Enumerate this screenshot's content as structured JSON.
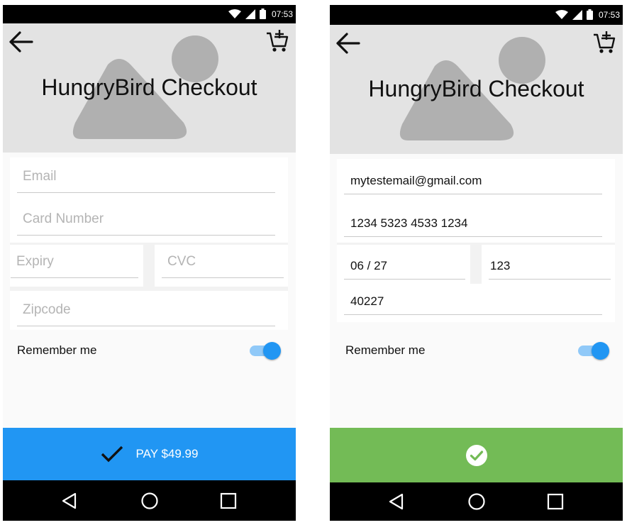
{
  "status_bar": {
    "time": "07:53"
  },
  "app": {
    "title": "HungryBird Checkout"
  },
  "checkout_empty": {
    "email_placeholder": "Email",
    "card_placeholder": "Card Number",
    "expiry_placeholder": "Expiry",
    "cvc_placeholder": "CVC",
    "zip_placeholder": "Zipcode",
    "remember_label": "Remember me",
    "remember_on": true,
    "pay_label": "PAY $49.99"
  },
  "checkout_filled": {
    "email": "mytestemail@gmail.com",
    "card_number": "1234 5323 4533 1234",
    "expiry": "06 / 27",
    "cvc": "123",
    "zip": "40227",
    "remember_label": "Remember me",
    "remember_on": true
  },
  "colors": {
    "pay_button": "#2196f3",
    "success_button": "#73bb56",
    "toggle_on": "#2196f3",
    "header_bg": "#e3e3e3"
  },
  "icons": {
    "back": "arrow-back-icon",
    "cart": "add-shopping-cart-icon",
    "pay": "check-icon",
    "success": "check-circle-icon",
    "nav_back": "triangle-back-icon",
    "nav_home": "circle-home-icon",
    "nav_recents": "square-recents-icon"
  }
}
